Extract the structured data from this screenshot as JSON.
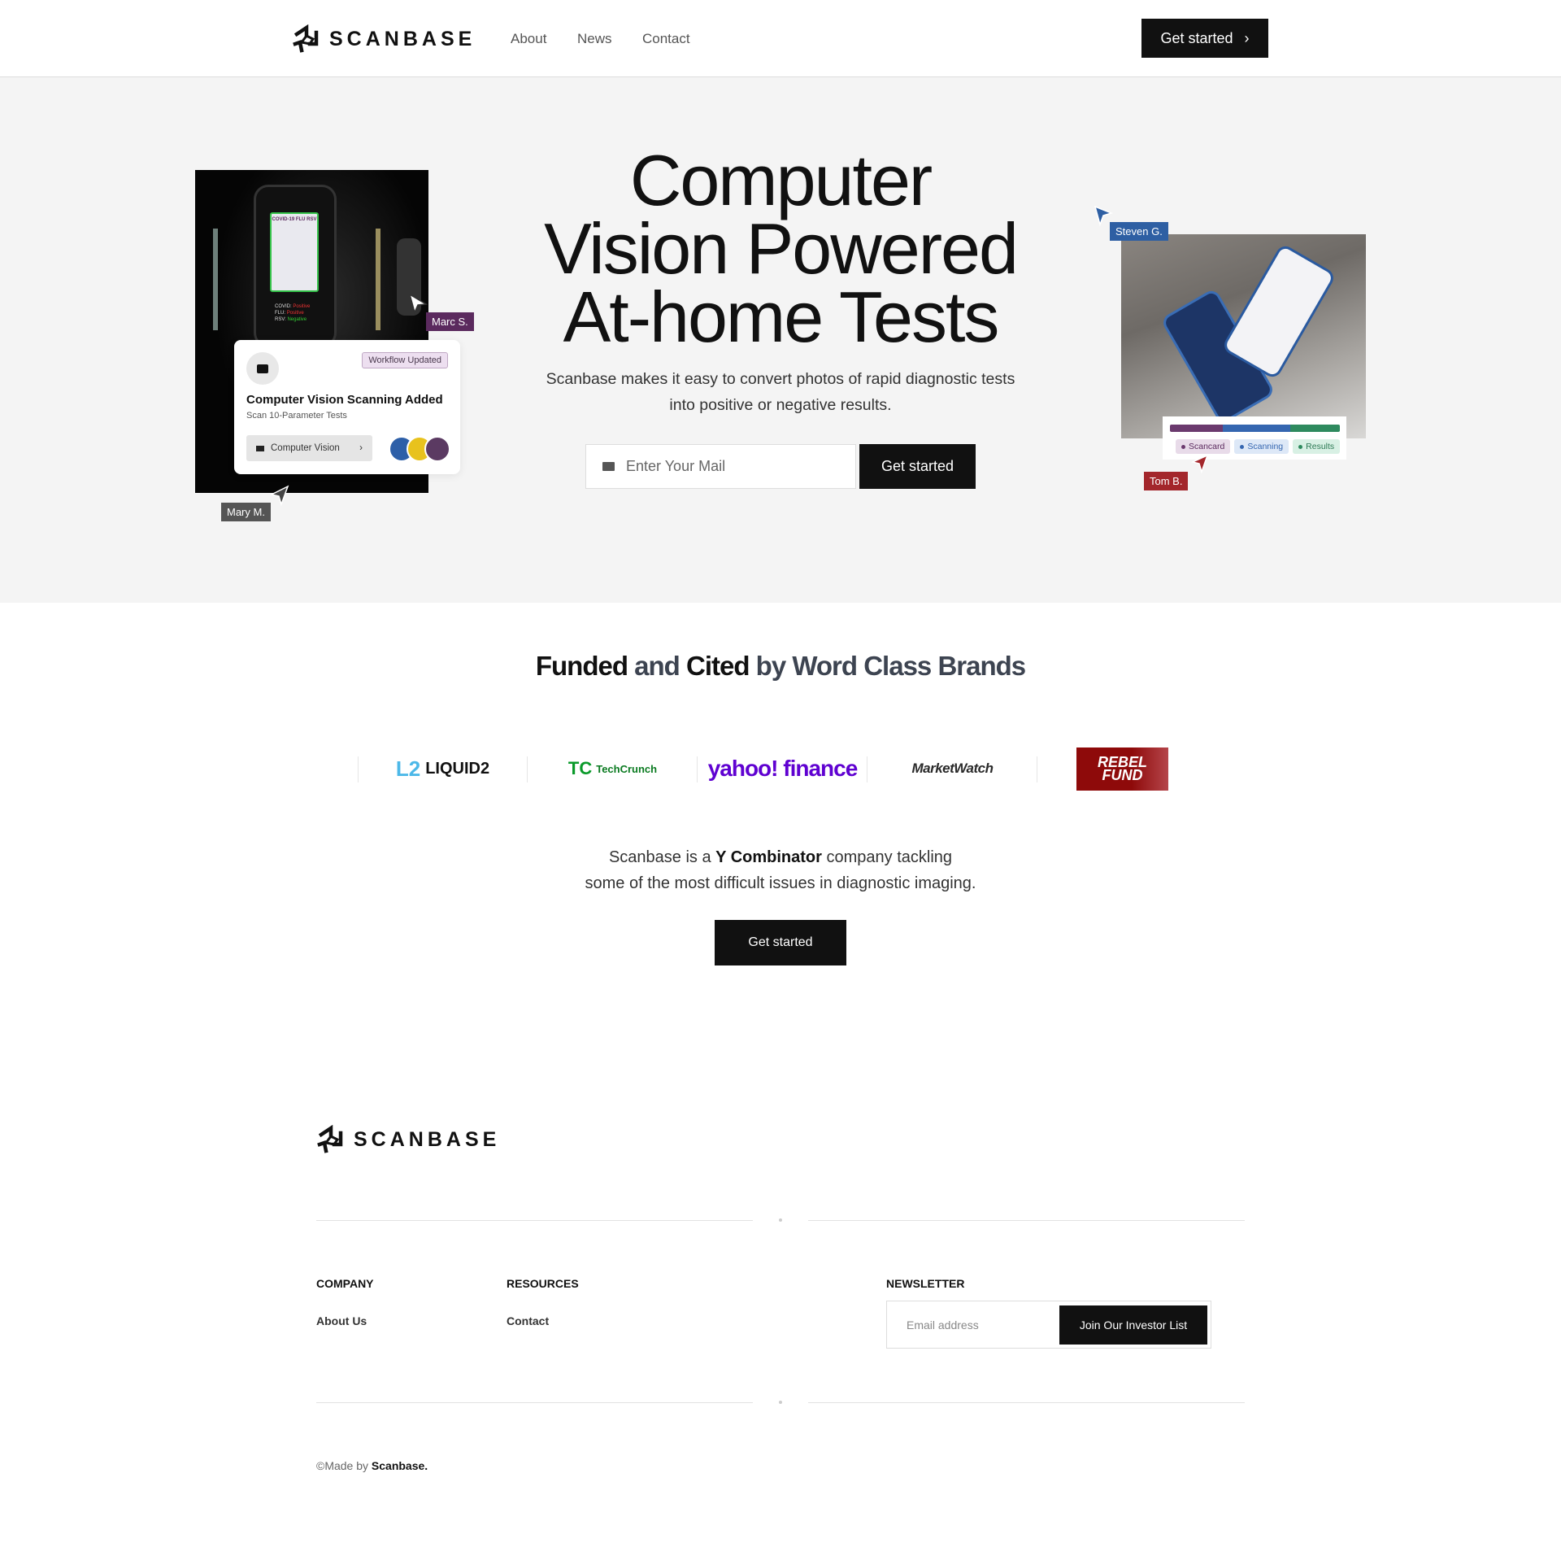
{
  "header": {
    "brand": "SCANBASE",
    "nav": [
      "About",
      "News",
      "Contact"
    ],
    "cta": "Get started"
  },
  "hero": {
    "title_lines": [
      "Computer",
      "Vision Powered",
      "At-home Tests"
    ],
    "subtitle_lines": [
      "Scanbase makes it easy to convert photos of rapid diagnostic tests",
      "into positive or negative results."
    ],
    "email_placeholder": "Enter Your Mail",
    "cta": "Get started",
    "left_card": {
      "badge": "Workflow Updated",
      "title": "Computer Vision Scanning Added",
      "subtitle": "Scan 10-Parameter Tests",
      "chip": "Computer Vision",
      "phone_title": "COVID-19 FLU RSV",
      "results": [
        {
          "label": "COVID:",
          "value": "Positive"
        },
        {
          "label": "FLU:",
          "value": "Positive"
        },
        {
          "label": "RSV:",
          "value": "Negative"
        }
      ]
    },
    "cursors": [
      {
        "name": "Marc S.",
        "color": "#5b2a5e"
      },
      {
        "name": "Mary M.",
        "color": "#555555"
      },
      {
        "name": "Steven G.",
        "color": "#2e5fa3"
      },
      {
        "name": "Tom B.",
        "color": "#a3262b"
      }
    ],
    "progress": {
      "steps": [
        {
          "label": "Scancard",
          "color": "#6b3a6e"
        },
        {
          "label": "Scanning",
          "color": "#3566b0"
        },
        {
          "label": "Results",
          "color": "#2e8a5e"
        }
      ]
    }
  },
  "brands": {
    "heading_parts": [
      {
        "text": "Funded ",
        "strong": true
      },
      {
        "text": "and ",
        "strong": false
      },
      {
        "text": "Cited ",
        "strong": true
      },
      {
        "text": "by Word Class Brands",
        "strong": false
      }
    ],
    "logos": [
      "LIQUID2",
      "TechCrunch",
      "yahoo! finance",
      "MarketWatch",
      "REBEL FUND"
    ],
    "yc_parts": [
      "Scanbase is a ",
      "Y Combinator",
      " company tackling"
    ],
    "yc_line2": "some of the most difficult issues in diagnostic imaging.",
    "cta": "Get started"
  },
  "footer": {
    "brand": "SCANBASE",
    "company_heading": "COMPANY",
    "company_links": [
      "About Us"
    ],
    "resources_heading": "RESOURCES",
    "resources_links": [
      "Contact"
    ],
    "newsletter_heading": "NEWSLETTER",
    "email_placeholder": "Email address",
    "join_button": "Join Our Investor List",
    "made_by_prefix": "©Made by ",
    "made_by_brand": "Scanbase."
  }
}
